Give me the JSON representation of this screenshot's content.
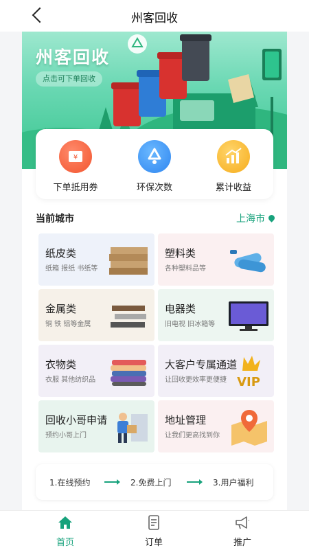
{
  "header": {
    "title": "州客回收"
  },
  "banner": {
    "title": "州客回收",
    "button": "点击可下单回收"
  },
  "stats": [
    {
      "label": "下单抵用券",
      "icon": "coupon-icon",
      "color": "#f2552f"
    },
    {
      "label": "环保次数",
      "icon": "recycle-icon",
      "color": "#2f86f0"
    },
    {
      "label": "累计收益",
      "icon": "chart-up-icon",
      "color": "#f6ac1c"
    }
  ],
  "section": {
    "title": "当前城市",
    "city": "上海市"
  },
  "categories": [
    {
      "title": "纸皮类",
      "sub": "纸箱 报纸 书纸等"
    },
    {
      "title": "塑料类",
      "sub": "各种塑料品等"
    },
    {
      "title": "金属类",
      "sub": "铜 铁 铝等金属"
    },
    {
      "title": "电器类",
      "sub": "旧电视 旧冰箱等"
    },
    {
      "title": "衣物类",
      "sub": "衣服 其他纺织品"
    },
    {
      "title": "大客户专属通道",
      "sub": "让回收更效率更便捷"
    },
    {
      "title": "回收小哥申请",
      "sub": "预约小哥上门"
    },
    {
      "title": "地址管理",
      "sub": "让我们更高找到你"
    }
  ],
  "steps": [
    "1.在线预约",
    "2.免费上门",
    "3.用户福利"
  ],
  "tabs": [
    {
      "label": "首页",
      "icon": "home-icon",
      "active": true
    },
    {
      "label": "订单",
      "icon": "order-icon",
      "active": false
    },
    {
      "label": "推广",
      "icon": "megaphone-icon",
      "active": false
    }
  ],
  "colors": {
    "accent": "#17a27c"
  }
}
